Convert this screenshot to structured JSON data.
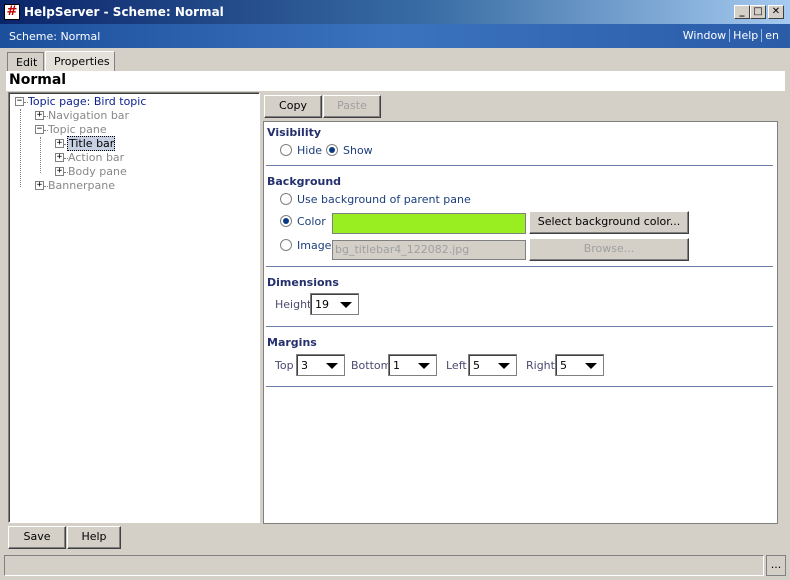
{
  "window": {
    "title": "HelpServer - Scheme: Normal",
    "icon_glyph": "#",
    "buttons": {
      "minimize": "_",
      "maximize": "□",
      "close": "✕"
    }
  },
  "banner": {
    "scheme_label": "Scheme: Normal",
    "links": [
      "Window",
      "Help",
      "en"
    ]
  },
  "tabs": [
    {
      "label": "Edit"
    },
    {
      "label": "Properties"
    }
  ],
  "scheme_name": "Normal",
  "tree": {
    "root": "Topic page: Bird topic",
    "navigation_bar": "Navigation bar",
    "topic_pane": "Topic pane",
    "title_bar": "Title bar",
    "action_bar": "Action bar",
    "body_pane": "Body pane",
    "banner_pane": "Bannerpane",
    "expand_glyph": "+",
    "collapse_glyph": "−"
  },
  "toolbar": {
    "copy": "Copy",
    "paste": "Paste"
  },
  "visibility": {
    "title": "Visibility",
    "hide": "Hide",
    "show": "Show",
    "selected": "show"
  },
  "background": {
    "title": "Background",
    "use_parent": "Use background of parent pane",
    "color": "Color",
    "image": "Image",
    "selected": "color",
    "color_value": "#99ee22",
    "select_color_button": "Select background color...",
    "image_file": "bg_titlebar4_122082.jpg",
    "browse_button": "Browse..."
  },
  "dimensions": {
    "title": "Dimensions",
    "height_label": "Height",
    "height_value": "19"
  },
  "margins": {
    "title": "Margins",
    "top_label": "Top",
    "top_value": "3",
    "bottom_label": "Bottom",
    "bottom_value": "1",
    "left_label": "Left",
    "left_value": "5",
    "right_label": "Right",
    "right_value": "5"
  },
  "footer": {
    "save": "Save",
    "help": "Help",
    "status_more": "..."
  }
}
